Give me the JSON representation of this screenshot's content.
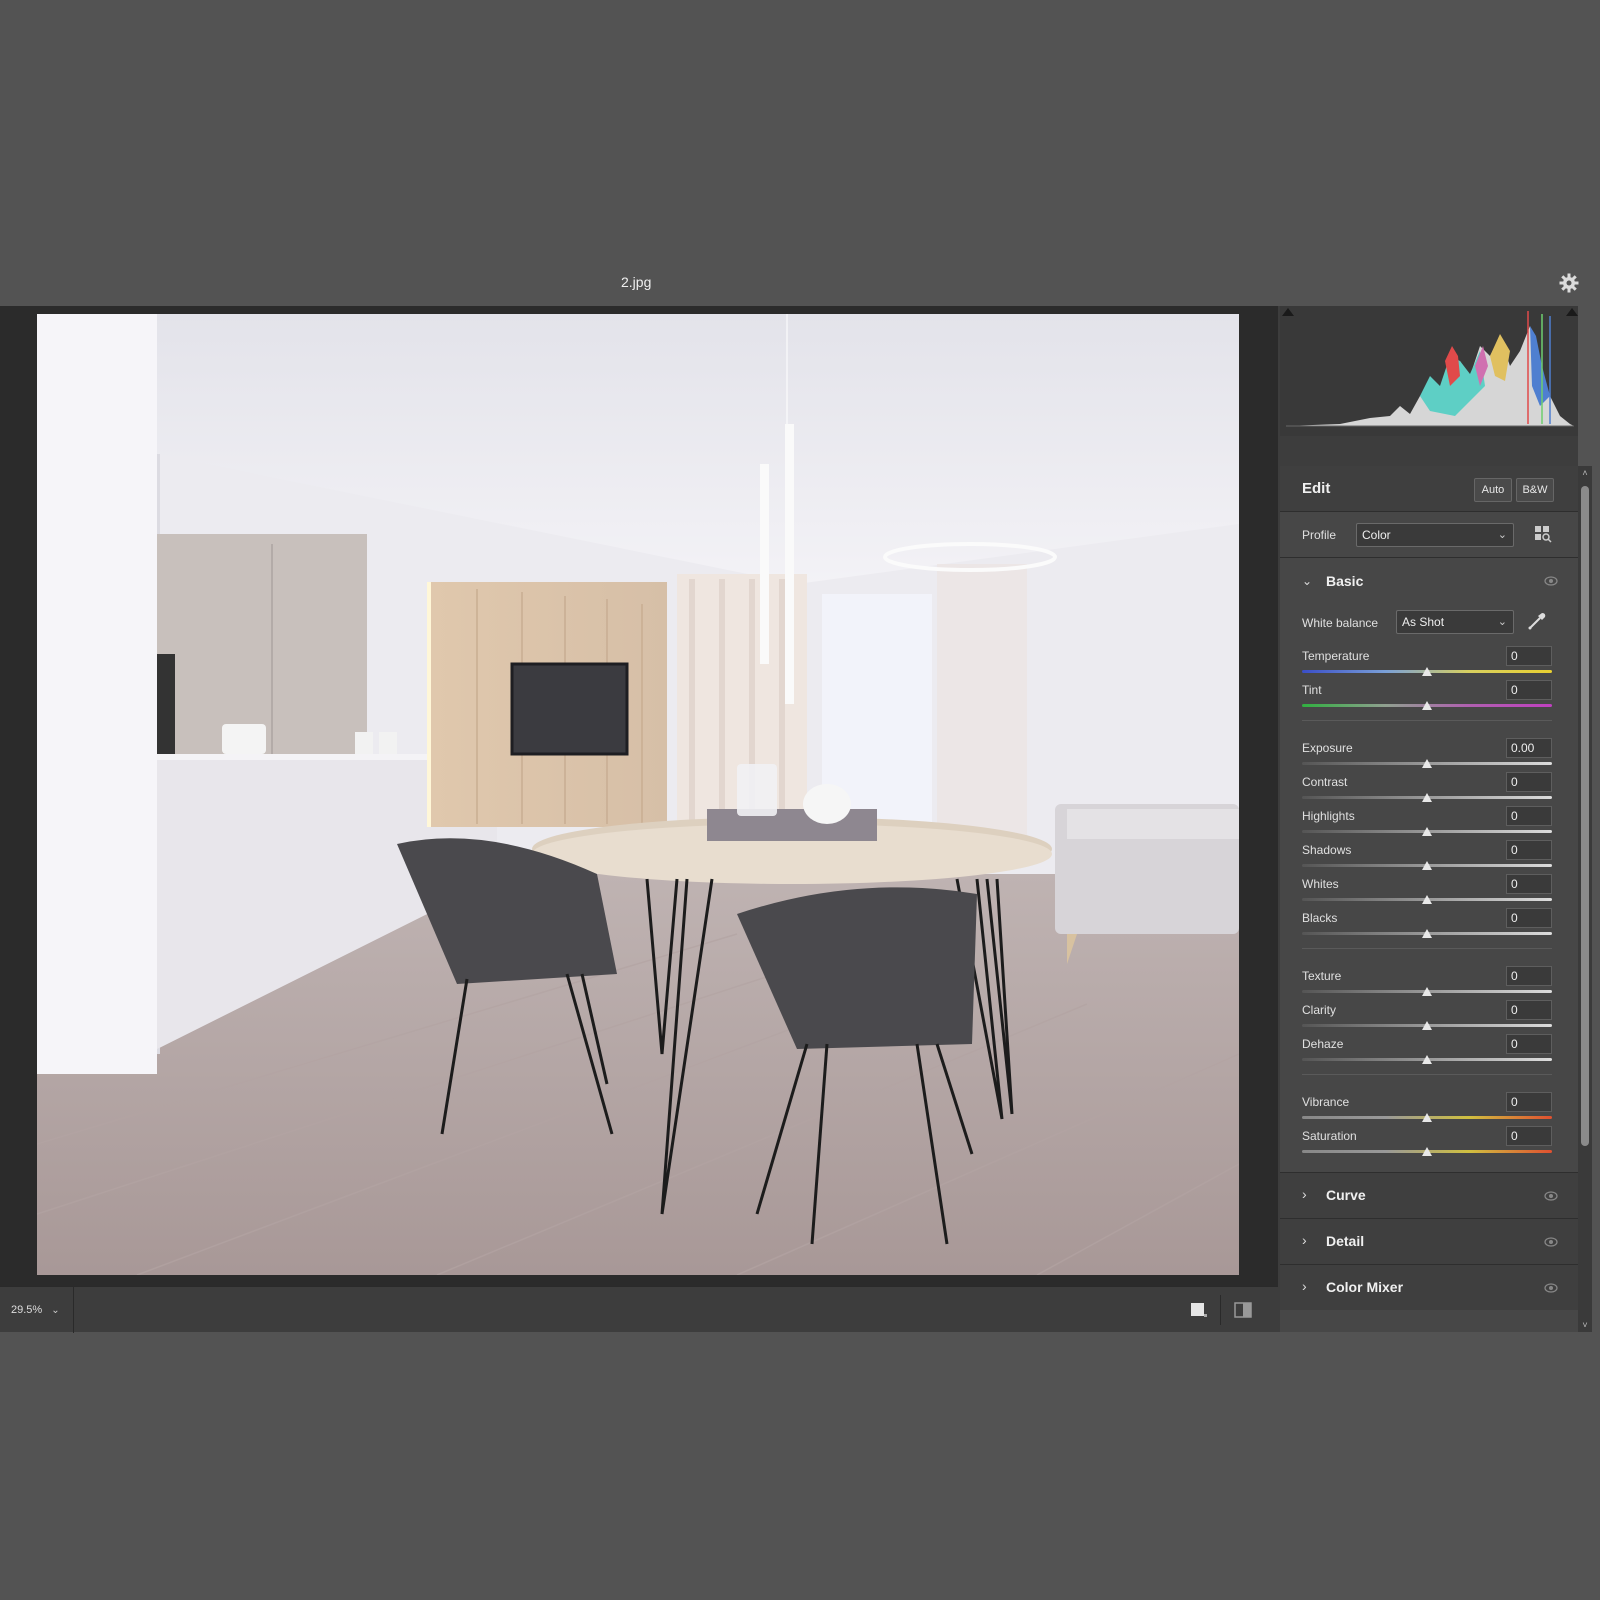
{
  "window": {
    "file_name": "2.jpg"
  },
  "bottom": {
    "zoom": "29.5%"
  },
  "panel": {
    "edit_title": "Edit",
    "auto_label": "Auto",
    "bw_label": "B&W",
    "profile_label": "Profile",
    "profile_value": "Color",
    "basic_title": "Basic",
    "white_balance_label": "White balance",
    "white_balance_value": "As Shot",
    "sliders": [
      {
        "label": "Temperature",
        "value": "0"
      },
      {
        "label": "Tint",
        "value": "0"
      },
      {
        "label": "Exposure",
        "value": "0.00"
      },
      {
        "label": "Contrast",
        "value": "0"
      },
      {
        "label": "Highlights",
        "value": "0"
      },
      {
        "label": "Shadows",
        "value": "0"
      },
      {
        "label": "Whites",
        "value": "0"
      },
      {
        "label": "Blacks",
        "value": "0"
      },
      {
        "label": "Texture",
        "value": "0"
      },
      {
        "label": "Clarity",
        "value": "0"
      },
      {
        "label": "Dehaze",
        "value": "0"
      },
      {
        "label": "Vibrance",
        "value": "0"
      },
      {
        "label": "Saturation",
        "value": "0"
      }
    ],
    "sections": [
      "Curve",
      "Detail",
      "Color Mixer"
    ]
  },
  "colors": {
    "bg": "#535353",
    "panel": "#474747",
    "workspace": "#2b2b2b"
  }
}
